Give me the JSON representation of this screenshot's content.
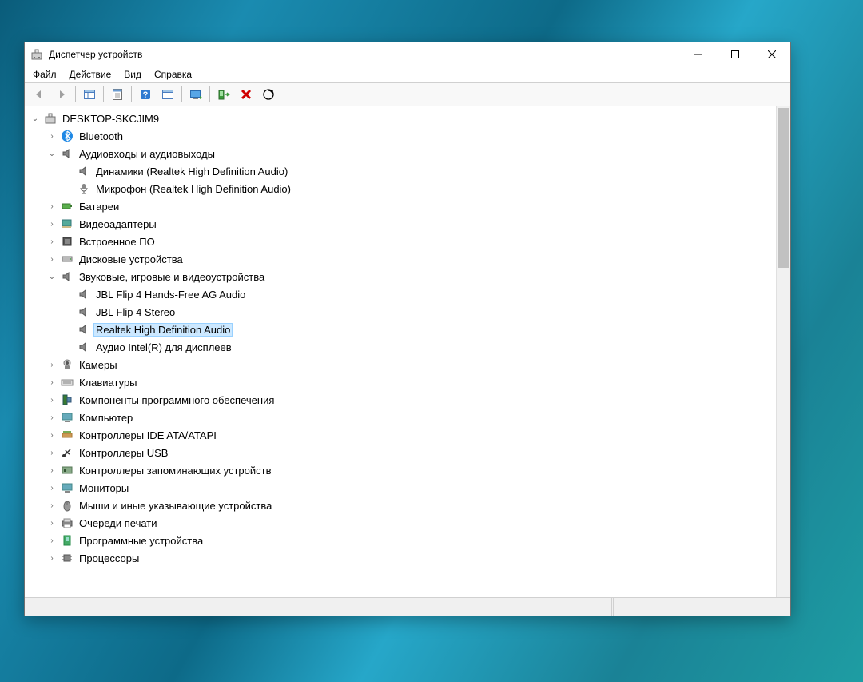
{
  "window": {
    "title": "Диспетчер устройств"
  },
  "menu": {
    "file": "Файл",
    "action": "Действие",
    "view": "Вид",
    "help": "Справка"
  },
  "tree": {
    "root": "DESKTOP-SKCJIM9",
    "bluetooth": "Bluetooth",
    "audio_io": "Аудиовходы и аудиовыходы",
    "audio_io_speakers": "Динамики (Realtek High Definition Audio)",
    "audio_io_mic": "Микрофон (Realtek High Definition Audio)",
    "batteries": "Батареи",
    "video_adapters": "Видеоадаптеры",
    "firmware": "Встроенное ПО",
    "disk_drives": "Дисковые устройства",
    "sound": "Звуковые, игровые и видеоустройства",
    "sound_jbl_ag": "JBL Flip 4 Hands-Free AG Audio",
    "sound_jbl_stereo": "JBL Flip 4 Stereo",
    "sound_realtek": "Realtek High Definition Audio",
    "sound_intel": "Аудио Intel(R) для дисплеев",
    "cameras": "Камеры",
    "keyboards": "Клавиатуры",
    "software_components": "Компоненты программного обеспечения",
    "computer": "Компьютер",
    "ide": "Контроллеры IDE ATA/ATAPI",
    "usb": "Контроллеры USB",
    "storage_controllers": "Контроллеры запоминающих устройств",
    "monitors": "Мониторы",
    "mice": "Мыши и иные указывающие устройства",
    "print_queues": "Очереди печати",
    "software_devices": "Программные устройства",
    "processors": "Процессоры"
  }
}
